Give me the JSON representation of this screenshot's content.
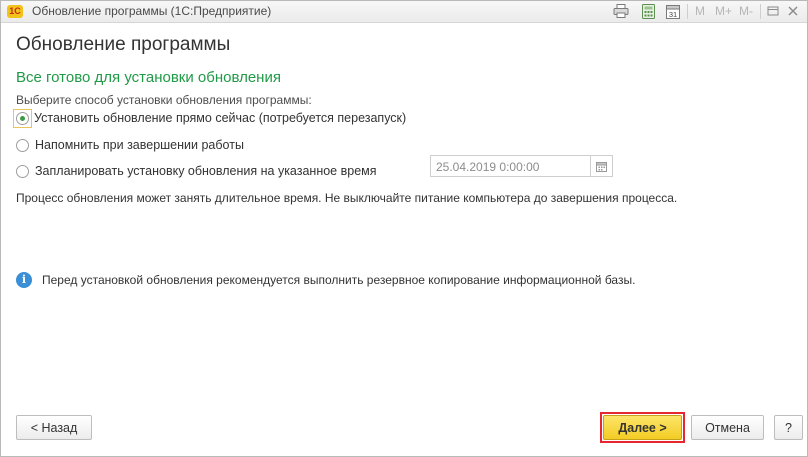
{
  "window": {
    "title": "Обновление программы  (1С:Предприятие)",
    "logo_text": "1С",
    "toolbar": {
      "icons": [
        "print-icon",
        "calculator-icon",
        "calendar-icon"
      ],
      "calendar_day": "31",
      "memory_buttons": [
        "M",
        "M+",
        "M-"
      ]
    }
  },
  "page": {
    "title": "Обновление программы",
    "section_title": "Все готово для установки обновления",
    "prompt": "Выберите способ установки обновления программы:",
    "options": [
      {
        "label": "Установить обновление прямо сейчас (потребуется перезапуск)",
        "selected": true
      },
      {
        "label": "Напомнить при завершении работы",
        "selected": false
      },
      {
        "label": "Запланировать установку обновления на указанное время",
        "selected": false
      }
    ],
    "scheduled_time": "25.04.2019  0:00:00",
    "note": "Процесс обновления может занять длительное время. Не выключайте питание компьютера до завершения процесса.",
    "info": "Перед установкой обновления рекомендуется выполнить резервное копирование информационной базы."
  },
  "buttons": {
    "back": "< Назад",
    "next": "Далее >",
    "cancel": "Отмена",
    "help": "?"
  },
  "colors": {
    "accent_green": "#1f9a46",
    "primary_button": "#f3cc23",
    "highlight_frame": "#e8262f",
    "info_blue": "#3a8fd6"
  }
}
